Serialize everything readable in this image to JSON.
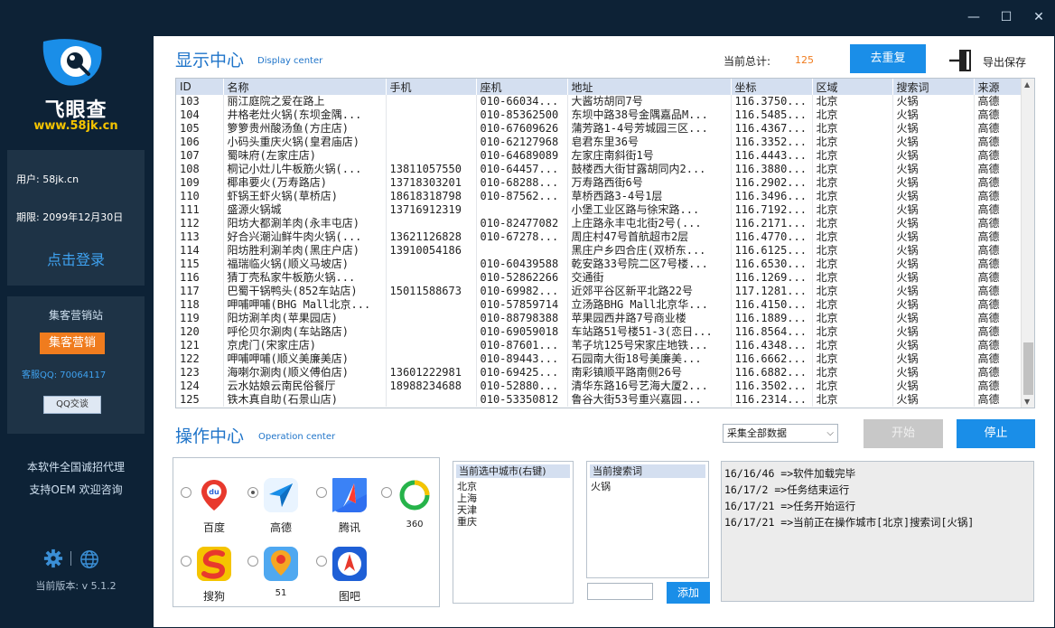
{
  "window": {
    "min": "—",
    "max": "☐",
    "close": "✕"
  },
  "sidebar": {
    "brand": "飞眼查",
    "url": "www.58jk.cn",
    "user": "用户: 58jk.cn",
    "expiry": "期限: 2099年12月30日",
    "login": "点击登录",
    "market_title": "集客营销站",
    "market_button": "集客营销",
    "qq": "客服QQ: 70064117",
    "qq_button": "QQ交谈",
    "agent1": "本软件全国诚招代理",
    "agent2": "支持OEM 欢迎咨询",
    "version": "当前版本: v 5.1.2"
  },
  "display": {
    "title": "显示中心",
    "subtitle": "Display center",
    "total_label": "当前总计:",
    "total_value": "125",
    "dedup_button": "去重复",
    "export_label": "导出保存"
  },
  "table": {
    "columns": [
      "ID",
      "名称",
      "手机",
      "座机",
      "地址",
      "坐标",
      "区域",
      "搜索词",
      "来源"
    ],
    "rows": [
      [
        "103",
        "丽江庭院之爱在路上",
        "",
        "010-66034...",
        "大酱坊胡同7号",
        "116.3750...",
        "北京",
        "火锅",
        "高德"
      ],
      [
        "104",
        "井格老灶火锅(东坝金隅...",
        "",
        "010-85362500",
        "东坝中路38号金隅嘉品M...",
        "116.5485...",
        "北京",
        "火锅",
        "高德"
      ],
      [
        "105",
        "箩箩贵州酸汤鱼(方庄店)",
        "",
        "010-67609626",
        "蒲芳路1-4号芳城园三区...",
        "116.4367...",
        "北京",
        "火锅",
        "高德"
      ],
      [
        "106",
        "小码头重庆火锅(皇君庙店)",
        "",
        "010-62127968",
        "皂君东里36号",
        "116.3352...",
        "北京",
        "火锅",
        "高德"
      ],
      [
        "107",
        "蜀味府(左家庄店)",
        "",
        "010-64689089",
        "左家庄南斜街1号",
        "116.4443...",
        "北京",
        "火锅",
        "高德"
      ],
      [
        "108",
        "桐记小灶儿牛板筋火锅(...",
        "13811057550",
        "010-64457...",
        "鼓楼西大街甘露胡同内2...",
        "116.3880...",
        "北京",
        "火锅",
        "高德"
      ],
      [
        "109",
        "椰串要火(万寿路店)",
        "13718303201",
        "010-68288...",
        "万寿路西街6号",
        "116.2902...",
        "北京",
        "火锅",
        "高德"
      ],
      [
        "110",
        "虾锅王虾火锅(草桥店)",
        "18618318798",
        "010-87562...",
        "草桥西路3-4号1层",
        "116.3496...",
        "北京",
        "火锅",
        "高德"
      ],
      [
        "111",
        "盛源火锅城",
        "13716912319",
        "",
        "小堡工业区路与徐宋路...",
        "116.7192...",
        "北京",
        "火锅",
        "高德"
      ],
      [
        "112",
        "阳坊大都涮羊肉(永丰屯店)",
        "",
        "010-82477082",
        "上庄路永丰屯北街2号(...",
        "116.2171...",
        "北京",
        "火锅",
        "高德"
      ],
      [
        "113",
        "好合兴潮汕鲜牛肉火锅(...",
        "13621126828",
        "010-67278...",
        "周庄村47号首航超市2层",
        "116.4770...",
        "北京",
        "火锅",
        "高德"
      ],
      [
        "114",
        "阳坊胜利涮羊肉(黑庄户店)",
        "13910054186",
        "",
        "黑庄户乡四合庄(双桥东...",
        "116.6125...",
        "北京",
        "火锅",
        "高德"
      ],
      [
        "115",
        "福瑞临火锅(顺义马坡店)",
        "",
        "010-60439588",
        "乾安路33号院二区7号楼...",
        "116.6530...",
        "北京",
        "火锅",
        "高德"
      ],
      [
        "116",
        "猜丁壳私家牛板筋火锅...",
        "",
        "010-52862266",
        "交通街",
        "116.1269...",
        "北京",
        "火锅",
        "高德"
      ],
      [
        "117",
        "巴蜀干锅鸭头(852车站店)",
        "15011588673",
        "010-69982...",
        "近郊平谷区新平北路22号",
        "117.1281...",
        "北京",
        "火锅",
        "高德"
      ],
      [
        "118",
        "呷哺呷哺(BHG Mall北京...",
        "",
        "010-57859714",
        "立汤路BHG Mall北京华...",
        "116.4150...",
        "北京",
        "火锅",
        "高德"
      ],
      [
        "119",
        "阳坊涮羊肉(苹果园店)",
        "",
        "010-88798388",
        "苹果园西井路7号商业楼",
        "116.1889...",
        "北京",
        "火锅",
        "高德"
      ],
      [
        "120",
        "呼伦贝尔涮肉(车站路店)",
        "",
        "010-69059018",
        "车站路51号楼51-3(恋日...",
        "116.8564...",
        "北京",
        "火锅",
        "高德"
      ],
      [
        "121",
        "京虎门(宋家庄店)",
        "",
        "010-87601...",
        "苇子坑125号宋家庄地铁...",
        "116.4348...",
        "北京",
        "火锅",
        "高德"
      ],
      [
        "122",
        "呷哺呷哺(顺义美廉美店)",
        "",
        "010-89443...",
        "石园南大街18号美廉美...",
        "116.6662...",
        "北京",
        "火锅",
        "高德"
      ],
      [
        "123",
        "海喇尔涮肉(顺义傅伯店)",
        "13601222981",
        "010-69425...",
        "南彩镇顺平路南侧26号",
        "116.6882...",
        "北京",
        "火锅",
        "高德"
      ],
      [
        "124",
        "云水姑娘云南民俗餐厅",
        "18988234688",
        "010-52880...",
        "清华东路16号艺海大厦2...",
        "116.3502...",
        "北京",
        "火锅",
        "高德"
      ],
      [
        "125",
        "铁木真自助(石景山店)",
        "",
        "010-53350812",
        "鲁谷大街53号重兴嘉园...",
        "116.2314...",
        "北京",
        "火锅",
        "高德"
      ]
    ]
  },
  "operation": {
    "title": "操作中心",
    "subtitle": "Operation center",
    "collect_select": "采集全部数据",
    "start_button": "开始",
    "stop_button": "停止",
    "sources": [
      {
        "label": "百度",
        "selected": false
      },
      {
        "label": "高德",
        "selected": true
      },
      {
        "label": "腾讯",
        "selected": false
      },
      {
        "label": "360",
        "selected": false
      },
      {
        "label": "搜狗",
        "selected": false
      },
      {
        "label": "51",
        "selected": false
      },
      {
        "label": "图吧",
        "selected": false
      }
    ],
    "cities_header": "当前选中城市(右键)",
    "cities": [
      "北京",
      "上海",
      "天津",
      "重庆"
    ],
    "keywords_header": "当前搜索词",
    "keywords": [
      "火锅"
    ],
    "add_button": "添加",
    "log": [
      "16/16/46 =>软件加载完毕",
      "16/17/2 =>任务结束运行",
      "16/17/21 =>任务开始运行",
      "16/17/21 =>当前正在操作城市[北京]搜索词[火锅]"
    ]
  },
  "colors": {
    "accent": "#1a8ee8",
    "sidebar": "#0d2236",
    "orange": "#f07c1e"
  }
}
